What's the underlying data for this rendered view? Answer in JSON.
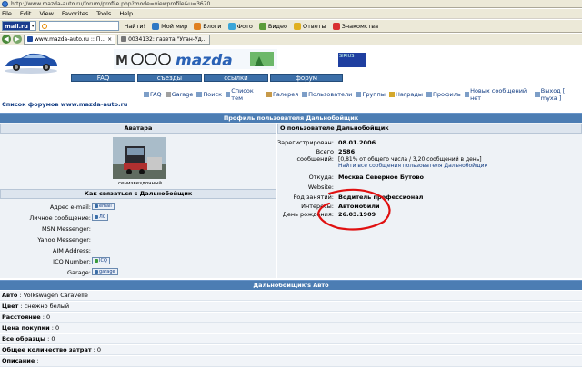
{
  "browser": {
    "address": "http://www.mazda-auto.ru/forum/profile.php?mode=viewprofile&u=3670",
    "menu": [
      "File",
      "Edit",
      "View",
      "Favorites",
      "Tools",
      "Help"
    ],
    "mail_logo": "mail.ru",
    "toolbar_buttons": [
      {
        "label": "Найти!",
        "icon": "search-icon",
        "color": "#e8a317"
      },
      {
        "label": "Мой мир",
        "icon": "people-icon",
        "color": "#2f78c4"
      },
      {
        "label": "Блоги",
        "icon": "blog-icon",
        "color": "#e08020"
      },
      {
        "label": "Фото",
        "icon": "photo-icon",
        "color": "#3aa5d8"
      },
      {
        "label": "Видео",
        "icon": "video-icon",
        "color": "#5b9b3a"
      },
      {
        "label": "Ответы",
        "icon": "answers-icon",
        "color": "#e0b020"
      },
      {
        "label": "Знакомства",
        "icon": "heart-icon",
        "color": "#d83030"
      }
    ],
    "tabs": [
      "www.mazda-auto.ru :: П...",
      "00341З2: газета \"Уган-Уд..."
    ]
  },
  "header": {
    "banner_text": "mazda",
    "mini_banner": "SIRIUS",
    "nav": [
      "FAQ",
      "съезды",
      "ссылки",
      "форум"
    ]
  },
  "links": [
    "FAQ",
    "Garage",
    "Поиск",
    "Список тем",
    "Галерея",
    "Пользователи",
    "Группы",
    "Награды",
    "Профиль",
    "Новых сообщений нет",
    "Выход [ myxa ]"
  ],
  "breadcrumb": "Список форумов www.mazda-auto.ru",
  "profile_title": "Профиль пользователя Дальнобойщик",
  "avatar": {
    "heading": "Аватара",
    "caption": "сенизвездочный"
  },
  "contact": {
    "heading": "Как связаться с Дальнобойщик",
    "rows": [
      {
        "label": "Адрес e-mail:",
        "button": "email"
      },
      {
        "label": "Личное сообщение:",
        "button": "ЛС"
      },
      {
        "label": "MSN Messenger:",
        "button": ""
      },
      {
        "label": "Yahoo Messenger:",
        "button": ""
      },
      {
        "label": "AIM Address:",
        "button": ""
      },
      {
        "label": "ICQ Number:",
        "button": "ICQ"
      },
      {
        "label": "Garage:",
        "button": "garage"
      }
    ]
  },
  "about": {
    "heading": "О пользователе Дальнобойщик",
    "registered_label": "Зарегистрирован:",
    "registered": "08.01.2006",
    "posts_label": "Всего сообщений:",
    "posts": "2586",
    "posts_share": "[0,81% от общего числа / 3,20 сообщений в день]",
    "find_posts": "Найти все сообщения пользователя Дальнобойщик",
    "location_label": "Откуда:",
    "location": "Москва Северное Бутово",
    "website_label": "Website:",
    "website": "",
    "occupation_label": "Род занятий:",
    "occupation": "Водитель профессионал",
    "interests_label": "Интересы:",
    "interests": "Автомобили",
    "birthday_label": "День рождения:",
    "birthday": "26.03.1909"
  },
  "car": {
    "heading": "Дальнобойщик's Авто",
    "rows": [
      {
        "label": "Авто",
        "value": ": Volkswagen Caravelle"
      },
      {
        "label": "Цвет",
        "value": ": снежно белый"
      },
      {
        "label": "Расстояние",
        "value": ": 0"
      },
      {
        "label": "Цена покупки",
        "value": ": 0"
      },
      {
        "label": "Все образцы",
        "value": ": 0"
      },
      {
        "label": "Общее количество затрат",
        "value": ": 0"
      },
      {
        "label": "Описание",
        "value": ":"
      }
    ]
  },
  "colors": {
    "bar": "#4c7db3",
    "annotation": "#e01010"
  }
}
